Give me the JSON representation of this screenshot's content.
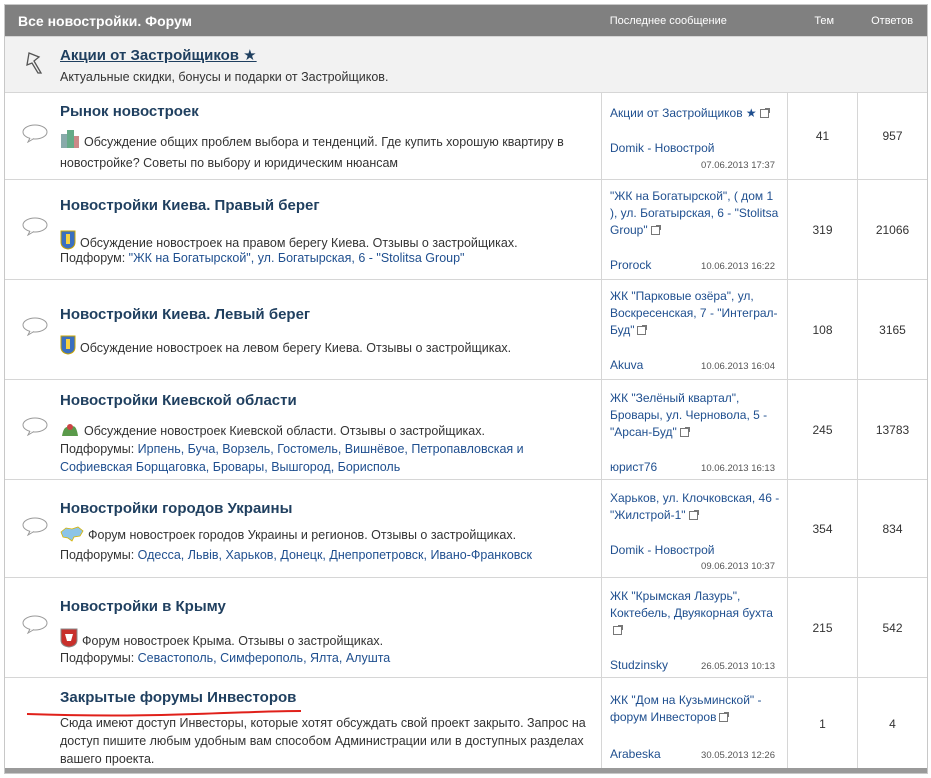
{
  "header": {
    "title": "Все новостройки. Форум",
    "last_post": "Последнее сообщение",
    "topics": "Тем",
    "replies": "Ответов"
  },
  "promo": {
    "title": "Акции от Застройщиков ★",
    "desc": "Актуальные скидки, бонусы и подарки от Застройщиков."
  },
  "forums": [
    {
      "title": "Рынок новостроек",
      "desc": "Обсуждение общих проблем выбора и тенденций. Где купить хорошую квартиру в новостройке? Советы по выбору и юридическим нюансам",
      "sub_label": "",
      "subforums": "",
      "last_title": "Акции от Застройщиков ★",
      "last_user": "Domik - Новострой",
      "last_date": "07.06.2013 17:37",
      "topics": "41",
      "replies": "957"
    },
    {
      "title": "Новостройки Киева. Правый берег",
      "desc": "Обсуждение новостроек на правом берегу Киева. Отзывы о застройщиках.",
      "sub_label": "Подфорум:",
      "subforums": "\"ЖК на Богатырской\", ул. Богатырская, 6 - \"Stolitsa Group\"",
      "last_title": "\"ЖК на Богатырской\", ( дом 1 ), ул. Богатырская, 6 - \"Stolitsa Group\"",
      "last_user": "Prorock",
      "last_date": "10.06.2013 16:22",
      "topics": "319",
      "replies": "21066"
    },
    {
      "title": "Новостройки Киева. Левый берег",
      "desc": "Обсуждение новостроек на левом берегу Киева. Отзывы о застройщиках.",
      "sub_label": "",
      "subforums": "",
      "last_title": "ЖК \"Парковые озёра\", ул, Воскресенская, 7 - \"Интеграл-Буд\"",
      "last_user": "Akuva",
      "last_date": "10.06.2013 16:04",
      "topics": "108",
      "replies": "3165"
    },
    {
      "title": "Новостройки Киевской области",
      "desc": "Обсуждение новостроек Киевской области. Отзывы о застройщиках.",
      "sub_label": "Подфорумы:",
      "subforums": "Ирпень, Буча, Ворзель, Гостомель, Вишнёвое, Петропавловская и Софиевская Борщаговка, Бровары, Вышгород, Борисполь",
      "last_title": "ЖК \"Зелёный квартал\", Бровары, ул. Черновола, 5 - \"Арсан-Буд\"",
      "last_user": "юрист76",
      "last_date": "10.06.2013 16:13",
      "topics": "245",
      "replies": "13783"
    },
    {
      "title": "Новостройки городов Украины",
      "desc": "Форум новостроек городов Украины и регионов. Отзывы о застройщиках.",
      "sub_label": "Подфорумы:",
      "subforums": "Одесса, Львів, Харьков, Донецк, Днепропетровск, Ивано-Франковск",
      "last_title": "Харьков, ул. Клочковская, 46 - \"Жилстрой-1\"",
      "last_user": "Domik - Новострой",
      "last_date": "09.06.2013 10:37",
      "topics": "354",
      "replies": "834"
    },
    {
      "title": "Новостройки в Крыму",
      "desc": "Форум новостроек Крыма. Отзывы о застройщиках.",
      "sub_label": "Подфорумы:",
      "subforums": "Севастополь, Симферополь, Ялта, Алушта",
      "last_title": "ЖК \"Крымская Лазурь\", Коктебель, Двуякорная бухта",
      "last_user": "Studzinsky",
      "last_date": "26.05.2013 10:13",
      "topics": "215",
      "replies": "542"
    },
    {
      "title": "Закрытые форумы Инвесторов",
      "desc": "Сюда имеют доступ Инвесторы, которые хотят обсуждать свой проект закрыто. Запрос на доступ пишите любым удобным вам способом Администрации или в доступных разделах вашего проекта.",
      "sub_label": "",
      "subforums": "",
      "last_title": "ЖК \"Дом на Кузьминской\" - форум Инвесторов",
      "last_user": "Arabeska",
      "last_date": "30.05.2013 12:26",
      "topics": "1",
      "replies": "4"
    }
  ]
}
